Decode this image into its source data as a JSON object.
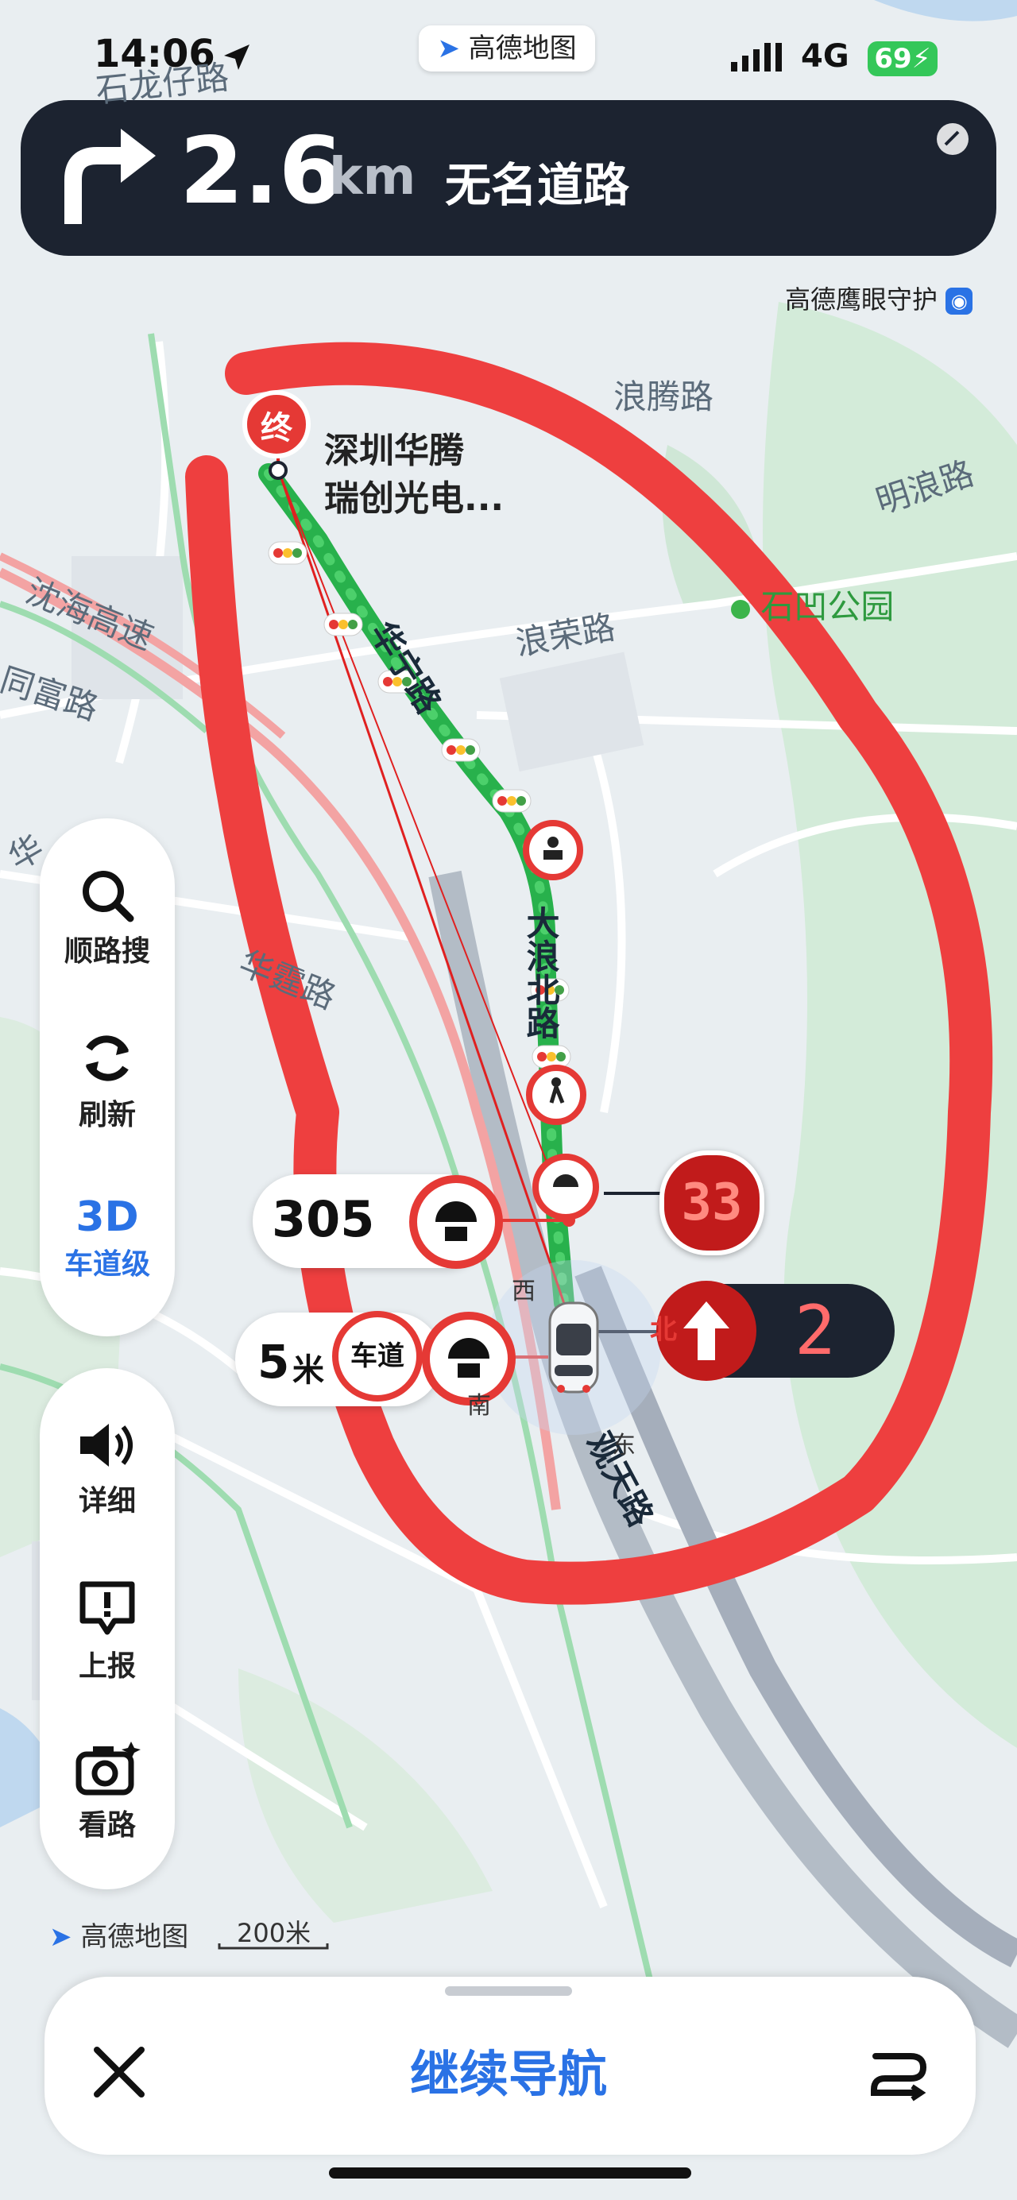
{
  "status_bar": {
    "time": "14:06",
    "network": "4G",
    "battery": "69"
  },
  "app_brand": "高德地图",
  "nav_banner": {
    "distance": "2.6",
    "unit": "km",
    "road": "无名道路"
  },
  "eagle_eye": "高德鹰眼守护",
  "map_labels": {
    "l1": "石龙仔路",
    "l2": "浪腾路",
    "l3": "明浪路",
    "l4": "沈海高速",
    "l5": "浪荣路",
    "l6": "石凹公园",
    "l7": "同富路",
    "l8": "华宁路",
    "l9": "华霆路",
    "l10": "大浪北路",
    "l11": "观天路",
    "l12": "华"
  },
  "destination": {
    "marker": "终",
    "name_line1": "深圳华腾",
    "name_line2": "瑞创光电..."
  },
  "side_panel": {
    "search": "顺路搜",
    "refresh": "刷新",
    "mode_3d": "3D",
    "lane_level": "车道级",
    "detail": "详细",
    "report": "上报",
    "view_road": "看路"
  },
  "lane_info": {
    "value": "305"
  },
  "dist_info": {
    "value": "5",
    "unit": "米",
    "tag": "车道"
  },
  "traffic_light": {
    "countdown": "33"
  },
  "lane_indicator": {
    "direction": "北",
    "lane": "2"
  },
  "compass": {
    "west": "西",
    "south": "南",
    "east": "东"
  },
  "scale": {
    "brand": "高德地图",
    "value": "200米"
  },
  "bottom_bar": {
    "continue_label": "继续导航"
  }
}
